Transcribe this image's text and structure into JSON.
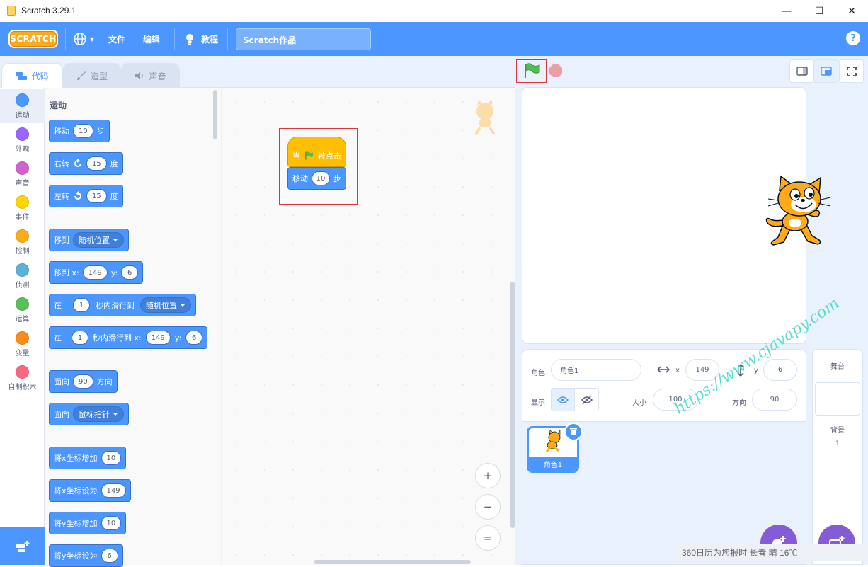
{
  "window": {
    "title": "Scratch 3.29.1",
    "minimize": "—",
    "maximize": "☐",
    "close": "✕"
  },
  "menubar": {
    "logo": "SCRATCH",
    "language_caret": "▾",
    "file": "文件",
    "edit": "编辑",
    "tutorials": "教程",
    "project_title": "Scratch作品",
    "help": "?"
  },
  "tabs": {
    "code": "代码",
    "costumes": "造型",
    "sounds": "声音"
  },
  "categories": [
    {
      "label": "运动",
      "color": "#4c97ff"
    },
    {
      "label": "外观",
      "color": "#9966ff"
    },
    {
      "label": "声音",
      "color": "#cf63cf"
    },
    {
      "label": "事件",
      "color": "#ffd500"
    },
    {
      "label": "控制",
      "color": "#ffab19"
    },
    {
      "label": "侦测",
      "color": "#5cb1d6"
    },
    {
      "label": "运算",
      "color": "#59c059"
    },
    {
      "label": "变量",
      "color": "#ff8c1a"
    },
    {
      "label": "自制积木",
      "color": "#ff6680"
    }
  ],
  "palette": {
    "heading": "运动",
    "move": {
      "label": "移动",
      "value": "10",
      "suffix": "步"
    },
    "turn_right": {
      "label": "右转",
      "value": "15",
      "suffix": "度"
    },
    "turn_left": {
      "label": "左转",
      "value": "15",
      "suffix": "度"
    },
    "go_to": {
      "label": "移到",
      "option": "随机位置"
    },
    "go_to_xy": {
      "label": "移到 x:",
      "x": "149",
      "y_label": "y:",
      "y": "6"
    },
    "glide_to": {
      "prefix": "在",
      "secs": "1",
      "label": "秒内滑行到",
      "option": "随机位置"
    },
    "glide_xy": {
      "prefix": "在",
      "secs": "1",
      "label": "秒内滑行到 x:",
      "x": "149",
      "y_label": "y:",
      "y": "6"
    },
    "point_dir": {
      "label": "面向",
      "value": "90",
      "suffix": "方向"
    },
    "point_towards": {
      "label": "面向",
      "option": "鼠标指针"
    },
    "change_x": {
      "label": "将x坐标增加",
      "value": "10"
    },
    "set_x": {
      "label": "将x坐标设为",
      "value": "149"
    },
    "change_y": {
      "label": "将y坐标增加",
      "value": "10"
    },
    "set_y": {
      "label": "将y坐标设为",
      "value": "6"
    }
  },
  "script": {
    "hat": {
      "prefix": "当",
      "suffix": "被点击"
    },
    "move": {
      "label": "移动",
      "value": "10",
      "suffix": "步"
    }
  },
  "zoom": {
    "in": "+",
    "out": "−",
    "reset": "="
  },
  "sprite_info": {
    "sprite_label": "角色",
    "sprite_name": "角色1",
    "x_label": "x",
    "x": "149",
    "y_label": "y",
    "y": "6",
    "show_label": "显示",
    "size_label": "大小",
    "size": "100",
    "direction_label": "方向",
    "direction": "90"
  },
  "sprites": [
    {
      "name": "角色1"
    }
  ],
  "stage_panel": {
    "title": "舞台",
    "backdrops_label": "背景",
    "backdrops_count": "1"
  },
  "watermark": "https://www.cjavapy.com",
  "statusbar": "360日历为您报时 长春 晴 16℃"
}
